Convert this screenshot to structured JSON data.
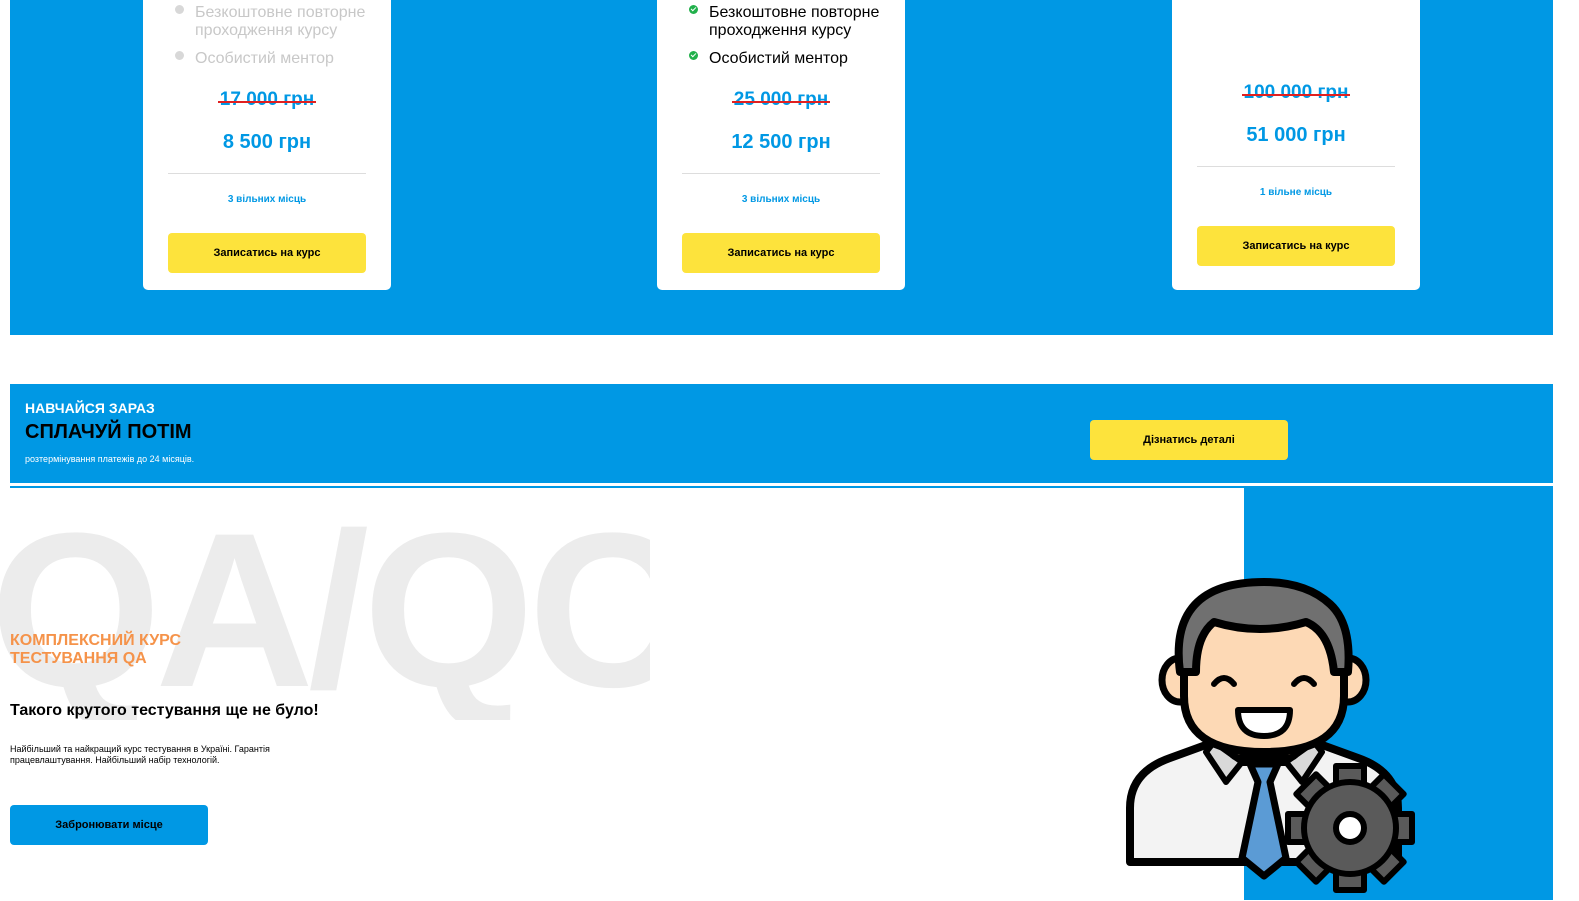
{
  "plans": [
    {
      "features": [
        {
          "text": "Безкоштовне повторне проходження курсу",
          "enabled": false
        },
        {
          "text": "Особистий ментор",
          "enabled": false
        }
      ],
      "old_price": "17 000 грн",
      "new_price": "8 500 грн",
      "seats": "3 вільних місць",
      "button": "Записатись на курс"
    },
    {
      "features": [
        {
          "text": "Безкоштовне повторне проходження курсу",
          "enabled": true
        },
        {
          "text": "Особистий ментор",
          "enabled": true
        }
      ],
      "old_price": "25 000 грн",
      "new_price": "12 500 грн",
      "seats": "3 вільних місць",
      "button": "Записатись на курс"
    },
    {
      "features": [],
      "old_price": "100 000 грн",
      "new_price": "51 000 грн",
      "seats": "1 вільне місць",
      "button": "Записатись на курс"
    }
  ],
  "installment": {
    "kicker": "НАВЧАЙСЯ ЗАРАЗ",
    "title": "СПЛАЧУЙ ПОТІМ",
    "note": "розтермінування платежів до 24 місяців.",
    "button": "Дізнатись деталі"
  },
  "hero": {
    "watermark": "QA/QC",
    "eyebrow": "КОМПЛЕКСНИЙ КУРС ТЕСТУВАННЯ QA",
    "title": "Такого крутого тестування ще не було!",
    "description": "Найбільший та найкращий курс тестування в Україні. Гарантія працевлаштування. Найбільший набір технологій.",
    "button": "Забронювати місце",
    "illustration_icon": "businessman-with-gear-icon"
  },
  "colors": {
    "brand_blue": "#0098e4",
    "cta_yellow": "#fde33c",
    "accent_orange": "#f5934a",
    "strike_red": "#e02020",
    "check_green": "#21b04b"
  }
}
